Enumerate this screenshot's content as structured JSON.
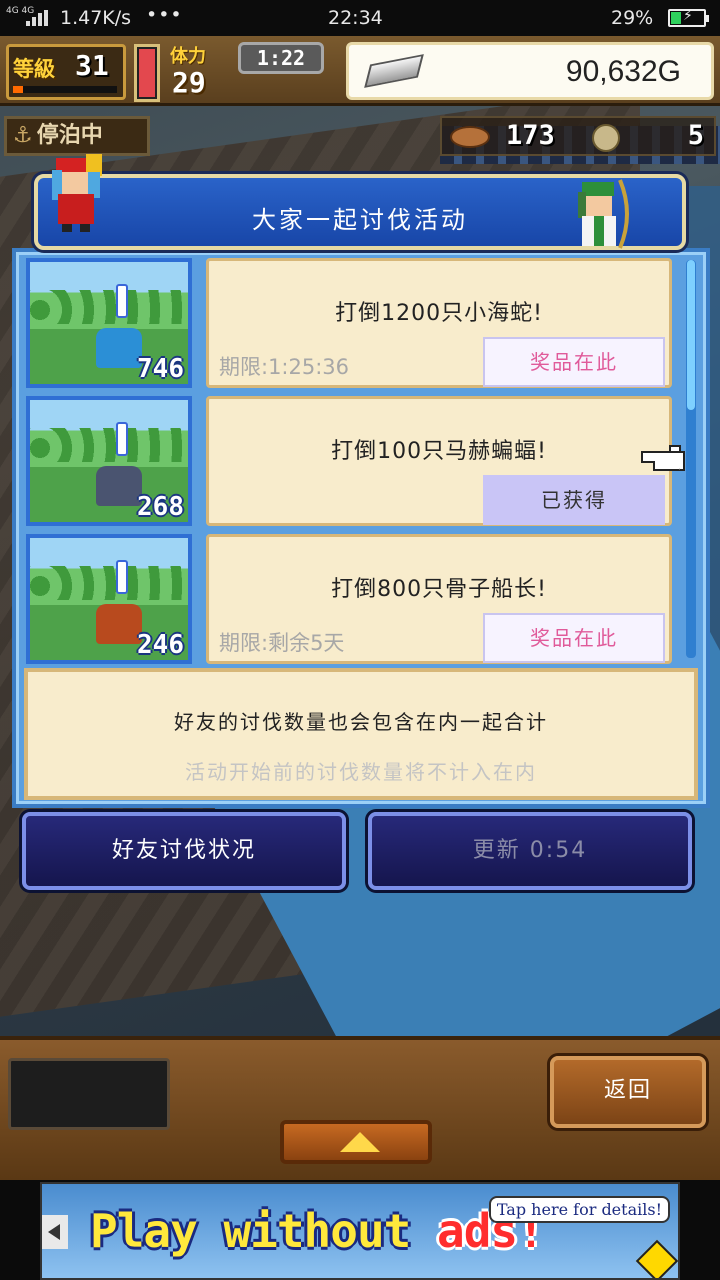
{
  "status_bar": {
    "network_type": "4G 4G",
    "net_speed": "1.47K/s",
    "dots": "•••",
    "time": "22:34",
    "battery": "29%",
    "battery_level": 0.29
  },
  "hud": {
    "level_label": "等級",
    "level": "31",
    "stamina_label": "体力",
    "stamina": "29",
    "timer": "1:22",
    "gold": "90,632G",
    "anchor_status": "停泊中",
    "cargo": "173",
    "coins": "5"
  },
  "dialog": {
    "title": "大家一起讨伐活动",
    "missions": [
      {
        "goal": "打倒1200只小海蛇!",
        "deadline": "期限:1:25:36",
        "action": "奖品在此",
        "action_type": "prize",
        "count": "746",
        "monster_color": "#2b8fd6"
      },
      {
        "goal": "打倒100只马赫蝙蝠!",
        "deadline": "",
        "action": "已获得",
        "action_type": "owned",
        "count": "268",
        "monster_color": "#4a5470"
      },
      {
        "goal": "打倒800只骨子船长!",
        "deadline": "期限:剩余5天",
        "action": "奖品在此",
        "action_type": "prize",
        "count": "246",
        "monster_color": "#b84a1e"
      }
    ],
    "note_line1": "好友的讨伐数量也会包含在内一起合计",
    "note_line2": "活动开始前的讨伐数量将不计入在内",
    "friend_status_button": "好友讨伐状况",
    "refresh_button": "更新 0:54"
  },
  "bottom": {
    "back_button": "返回"
  },
  "ad": {
    "title_main": "Play without ",
    "title_red": "ads!",
    "tip": "Tap here for details!"
  }
}
